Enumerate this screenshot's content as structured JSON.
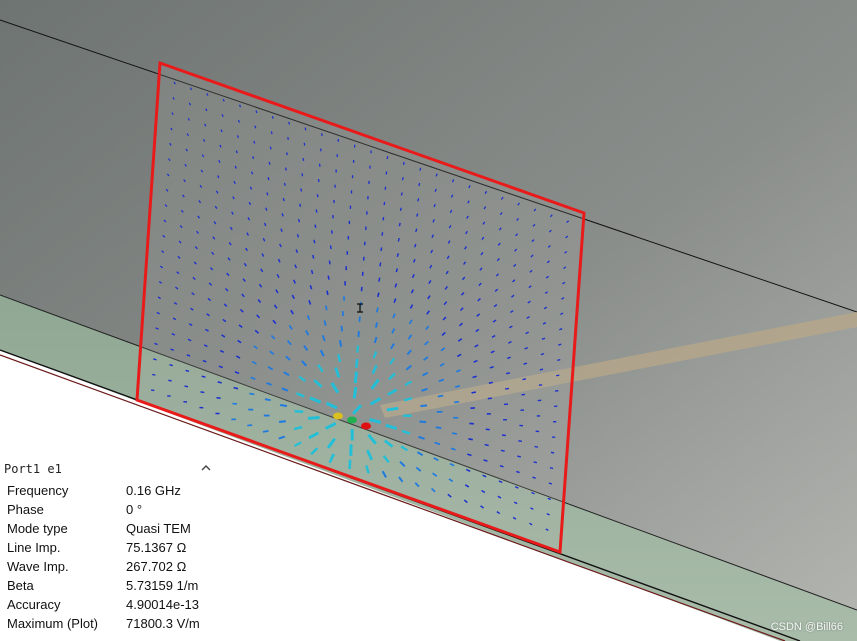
{
  "info_panel": {
    "title": "Port1 e1",
    "rows": [
      {
        "label": "Frequency",
        "value": "0.16 GHz"
      },
      {
        "label": "Phase",
        "value": "0 °"
      },
      {
        "label": "Mode type",
        "value": "Quasi TEM"
      },
      {
        "label": "Line Imp.",
        "value": "75.1367 Ω"
      },
      {
        "label": "Wave Imp.",
        "value": "267.702 Ω"
      },
      {
        "label": "Beta",
        "value": "5.73159 1/m"
      },
      {
        "label": "Accuracy",
        "value": "4.90014e-13"
      },
      {
        "label": "Maximum (Plot)",
        "value": "71800.3 V/m"
      }
    ],
    "collapse_icon": "chevron-up-icon"
  },
  "viewport": {
    "cursor_icon": "text-cursor-icon",
    "colors": {
      "background_top": "#6f7573",
      "background_bottom": "#a8aba6",
      "substrate": "#95ab98",
      "port_outline": "#e81a1a",
      "trace": "#b8a888",
      "arrow_low": "#1a2fd0",
      "arrow_mid": "#22c0d8",
      "arrow_high": "#e01010"
    }
  },
  "watermark": "CSDN @Bill66"
}
